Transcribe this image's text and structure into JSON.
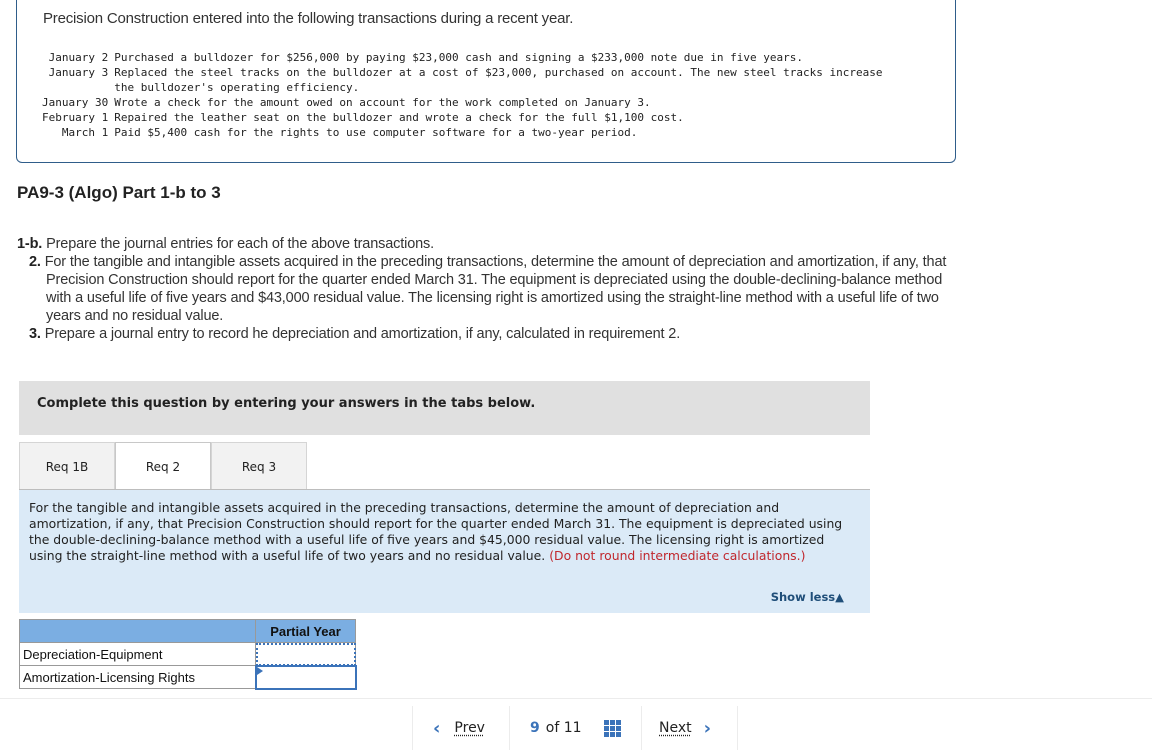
{
  "problem": {
    "intro": "Precision Construction entered into the following transactions during a recent year.",
    "transactions": [
      {
        "date": "January 2",
        "text": "Purchased a bulldozer for $256,000 by paying $23,000 cash and signing a $233,000 note due in five years."
      },
      {
        "date": "January 3",
        "text": "Replaced the steel tracks on the bulldozer at a cost of $23,000, purchased on account. The new steel tracks increase the bulldozer's operating efficiency."
      },
      {
        "date": "January 30",
        "text": "Wrote a check for the amount owed on account for the work completed on January 3."
      },
      {
        "date": "February 1",
        "text": "Repaired the leather seat on the bulldozer and wrote a check for the full $1,100 cost."
      },
      {
        "date": "March 1",
        "text": "Paid $5,400 cash for the rights to use computer software for a two-year period."
      }
    ]
  },
  "part_title": "PA9-3 (Algo) Part 1-b to 3",
  "requirements": [
    {
      "num": "1-b.",
      "text": "Prepare the journal entries for each of the above transactions."
    },
    {
      "num": "2.",
      "text": "For the tangible and intangible assets acquired in the preceding transactions, determine the amount of depreciation and amortization, if any, that Precision Construction should report for the quarter ended March 31. The equipment is depreciated using the double-declining-balance method with a useful life of five years and $43,000 residual value. The licensing right is amortized using the straight-line method with a useful life of two years and no residual value."
    },
    {
      "num": "3.",
      "text": "Prepare a journal entry to record he depreciation and amortization, if any, calculated in requirement 2."
    }
  ],
  "instruction": "Complete this question by entering your answers in the tabs below.",
  "tabs": [
    {
      "label": "Req 1B",
      "active": false
    },
    {
      "label": "Req 2",
      "active": true
    },
    {
      "label": "Req 3",
      "active": false
    }
  ],
  "question": {
    "text": "For the tangible and intangible assets acquired in the preceding transactions, determine the amount of depreciation and amortization, if any, that Precision Construction should report for the quarter ended March 31. The equipment is depreciated using the double-declining-balance method with a useful life of five years and $45,000 residual value. The licensing right is amortized using the straight-line method with a useful life of two years and no residual value.",
    "note": "(Do not round intermediate calculations.)",
    "show_less": "Show less",
    "show_less_icon": "triangle-up-icon"
  },
  "answer_table": {
    "column_header": "Partial Year",
    "rows": [
      {
        "label": "Depreciation-Equipment",
        "value": ""
      },
      {
        "label": "Amortization-Licensing Rights",
        "value": ""
      }
    ]
  },
  "navigation": {
    "prev_label": "Prev",
    "next_label": "Next",
    "current_page": "9",
    "of_label": "of",
    "total_pages": "11",
    "prev_icon": "chevron-left-icon",
    "next_icon": "chevron-right-icon",
    "grid_icon": "grid-icon"
  }
}
